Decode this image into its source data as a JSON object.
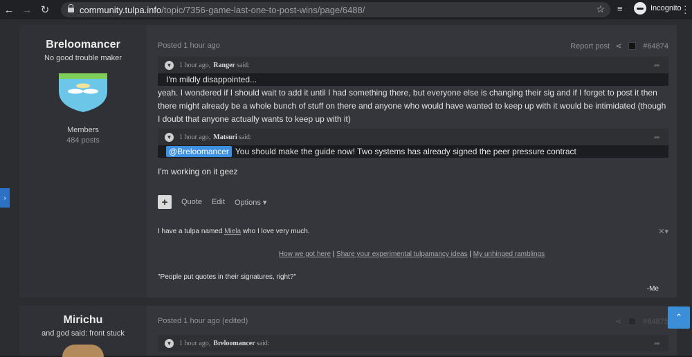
{
  "browser": {
    "url_host": "community.tulpa.info",
    "url_path": "/topic/7356-game-last-one-to-post-wins/page/6488/",
    "incognito_label": "Incognito",
    "back_icon": "←",
    "forward_icon": "→",
    "reload_icon": "↻",
    "star_icon": "☆",
    "playlist_icon": "≡"
  },
  "colors": {
    "accent": "#3d8fe0",
    "side_tab": "#2d71c4"
  },
  "post1": {
    "author_name": "Breloomancer",
    "author_title": "No good trouble maker",
    "group": "Members",
    "post_count": "484 posts",
    "posted": "Posted 1 hour ago",
    "report_label": "Report post",
    "post_number": "#64874",
    "quote1": {
      "time": "1 hour ago,",
      "author": "Ranger",
      "said": "said:",
      "text": "I'm mildly disappointed..."
    },
    "reply1": "yeah. I wondered if I should wait to add it until I had something there, but everyone else is changing their sig and if I forget to post it then there might already be a whole bunch of stuff on there and anyone who would have wanted to keep up with it would be intimidated (though I doubt that anyone actually wants to keep up with it)",
    "quote2": {
      "time": "1 hour ago,",
      "author": "Matsuri",
      "said": "said:",
      "mention": "@Breloomancer",
      "text": "You should make the guide now! Two systems has already signed the peer pressure contract"
    },
    "reply2": "I'm working on it geez",
    "actions": {
      "plus": "+",
      "quote": "Quote",
      "edit": "Edit",
      "options": "Options ▾"
    },
    "signature": {
      "line1_pre": "I have a tulpa named ",
      "line1_link": "Miela",
      "line1_post": " who I love very much.",
      "close": "✕▾",
      "link1": "How we got here",
      "sep": " | ",
      "link2": "Share your experimental tulpamancy ideas",
      "link3": "My unhinged ramblings",
      "quote": "\"People put quotes in their signatures, right?\"",
      "attribution": "-Me"
    }
  },
  "post2": {
    "author_name": "Mirichu",
    "author_title": "and god said: front stuck",
    "posted": "Posted 1 hour ago (edited)",
    "post_number": "#64875",
    "quote1": {
      "time": "1 hour ago,",
      "author": "Breloomancer",
      "said": "said:"
    }
  },
  "scroll_top_icon": "⌃"
}
